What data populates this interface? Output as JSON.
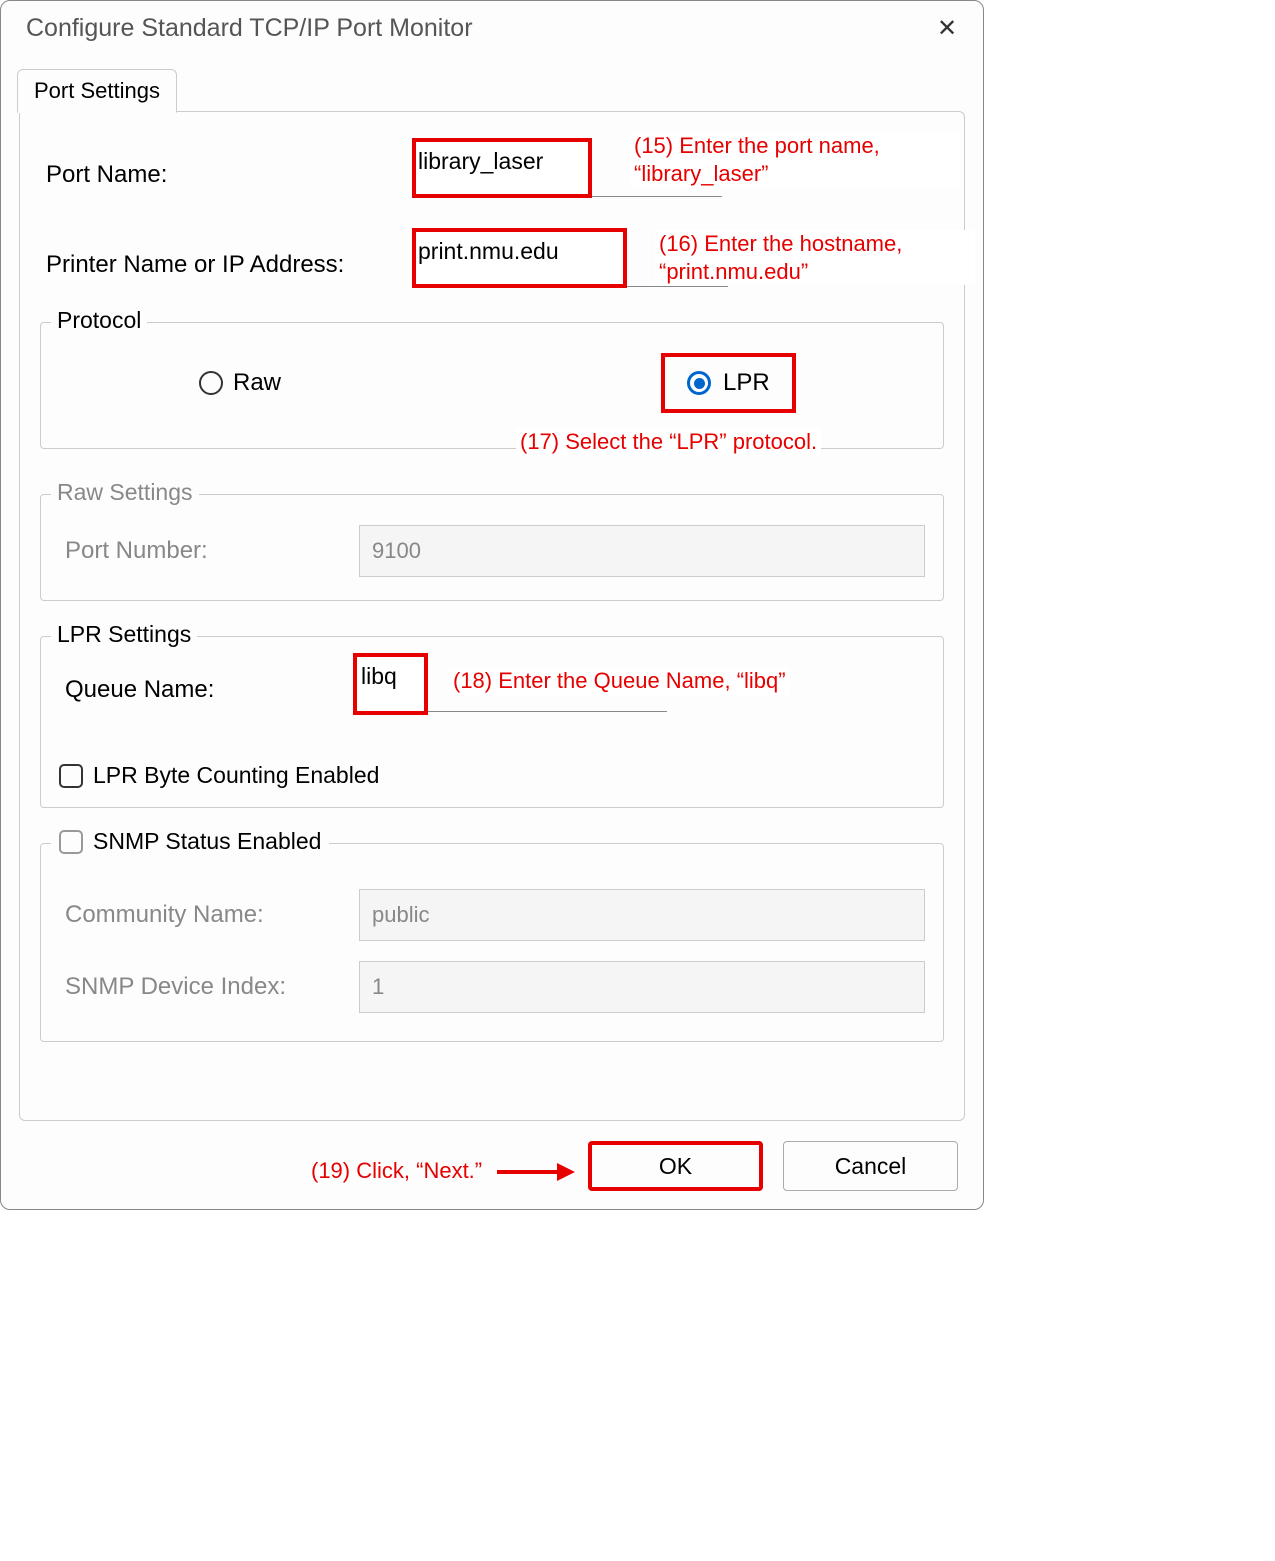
{
  "dialog": {
    "title": "Configure Standard TCP/IP Port Monitor"
  },
  "tab": {
    "label": "Port Settings"
  },
  "port_name": {
    "label": "Port Name:",
    "value": "library_laser"
  },
  "printer_addr": {
    "label": "Printer Name or IP Address:",
    "value": "print.nmu.edu"
  },
  "protocol": {
    "legend": "Protocol",
    "raw_label": "Raw",
    "lpr_label": "LPR",
    "selected": "LPR"
  },
  "raw_settings": {
    "legend": "Raw Settings",
    "port_number_label": "Port Number:",
    "port_number_value": "9100"
  },
  "lpr_settings": {
    "legend": "LPR Settings",
    "queue_label": "Queue Name:",
    "queue_value": "libq",
    "byte_counting_label": "LPR Byte Counting Enabled",
    "byte_counting_checked": false
  },
  "snmp": {
    "legend": "SNMP Status Enabled",
    "checked": false,
    "community_label": "Community Name:",
    "community_value": "public",
    "device_index_label": "SNMP Device Index:",
    "device_index_value": "1"
  },
  "buttons": {
    "ok": "OK",
    "cancel": "Cancel"
  },
  "annotations": {
    "a15": "(15) Enter the port name, “library_laser”",
    "a16": "(16) Enter the hostname, “print.nmu.edu”",
    "a17": "(17) Select the “LPR” protocol.",
    "a18": "(18) Enter the Queue Name, “libq”",
    "a19": "(19) Click, “Next.”"
  }
}
